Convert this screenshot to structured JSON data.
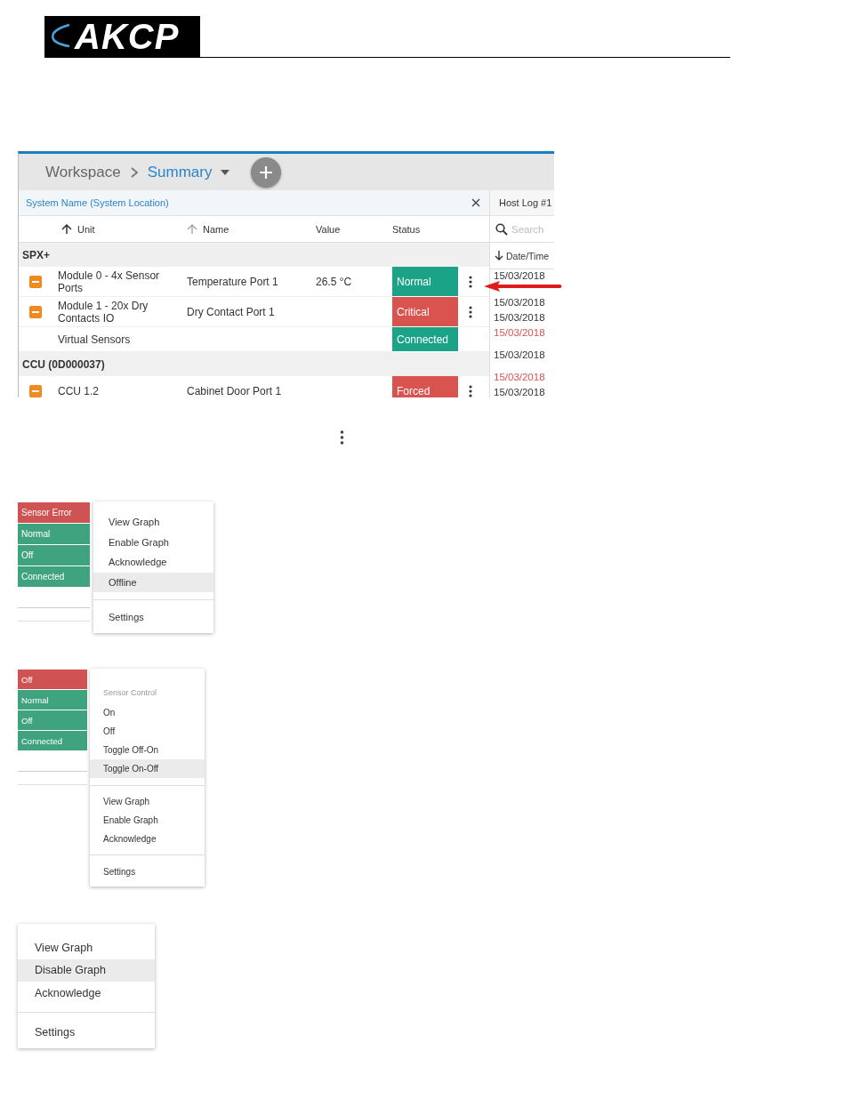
{
  "logo": {
    "text": "AKCP"
  },
  "summary_screen": {
    "breadcrumb": [
      {
        "label": "Workspace",
        "current": false
      },
      {
        "label": "Summary",
        "current": true
      }
    ],
    "panel": {
      "title": "System Name (System Location)",
      "columns": [
        {
          "label": "Unit",
          "sorted": true
        },
        {
          "label": "Name",
          "sorted": false
        },
        {
          "label": "Value"
        },
        {
          "label": "Status"
        }
      ],
      "groups": [
        {
          "name": "SPX+",
          "rows": [
            {
              "unit": "Module 0 - 4x Sensor Ports",
              "name": "Temperature Port 1",
              "value": "26.5 °C",
              "status": "Normal",
              "color": "#1aa386",
              "expandable": true,
              "has_menu": true
            },
            {
              "unit": "Module 1 - 20x Dry Contacts IO",
              "name": "Dry Contact Port 1",
              "status": "Critical",
              "color": "#d9534f",
              "expandable": true,
              "has_menu": true
            },
            {
              "unit": "Virtual Sensors",
              "status": "Connected",
              "color": "#1aa386",
              "expandable": false,
              "has_menu": false
            }
          ]
        },
        {
          "name": "CCU (0D000037)",
          "rows": [
            {
              "unit": "CCU 1.2",
              "name": "Cabinet Door Port 1",
              "status": "Forced",
              "color": "#d9534f",
              "expandable": true,
              "has_menu": true
            }
          ]
        }
      ]
    },
    "host_log": {
      "tab": "Host Log #1",
      "search_placeholder": "Search",
      "column": "Date/Time",
      "entries": [
        {
          "text": "15/03/2018",
          "alert": false
        },
        {
          "text": "15/03/2018",
          "alert": false
        },
        {
          "text": "15/03/2018",
          "alert": false
        },
        {
          "text": "15/03/2018",
          "alert": true
        },
        {
          "text": "15/03/2018",
          "alert": false
        },
        {
          "text": "15/03/2018",
          "alert": true
        },
        {
          "text": "15/03/2018",
          "alert": false
        }
      ]
    }
  },
  "menus": [
    {
      "status_cells": [
        {
          "label": "Sensor Error",
          "color": "#d05353"
        },
        {
          "label": "Normal",
          "color": "#3fa37f"
        },
        {
          "label": "Off",
          "color": "#3fa37f"
        },
        {
          "label": "Connected",
          "color": "#3fa37f"
        }
      ],
      "items": [
        {
          "kind": "item",
          "label": "View Graph",
          "selected": false
        },
        {
          "kind": "item",
          "label": "Enable Graph",
          "selected": false
        },
        {
          "kind": "item",
          "label": "Acknowledge",
          "selected": false
        },
        {
          "kind": "item",
          "label": "Offline",
          "selected": true
        },
        {
          "kind": "divider"
        },
        {
          "kind": "item",
          "label": "Settings",
          "selected": false
        }
      ]
    },
    {
      "status_cells": [
        {
          "label": "Off",
          "color": "#d05353"
        },
        {
          "label": "Normal",
          "color": "#3fa37f"
        },
        {
          "label": "Off",
          "color": "#3fa37f"
        },
        {
          "label": "Connected",
          "color": "#3fa37f"
        }
      ],
      "items": [
        {
          "kind": "header",
          "label": "Sensor Control"
        },
        {
          "kind": "item",
          "label": "On",
          "selected": false
        },
        {
          "kind": "item",
          "label": "Off",
          "selected": false
        },
        {
          "kind": "item",
          "label": "Toggle Off-On",
          "selected": false
        },
        {
          "kind": "item",
          "label": "Toggle On-Off",
          "selected": true
        },
        {
          "kind": "divider"
        },
        {
          "kind": "item",
          "label": "View Graph",
          "selected": false
        },
        {
          "kind": "item",
          "label": "Enable Graph",
          "selected": false
        },
        {
          "kind": "item",
          "label": "Acknowledge",
          "selected": false
        },
        {
          "kind": "divider"
        },
        {
          "kind": "item",
          "label": "Settings",
          "selected": false
        }
      ]
    },
    {
      "items": [
        {
          "kind": "item",
          "label": "View Graph",
          "selected": false
        },
        {
          "kind": "item",
          "label": "Disable Graph",
          "selected": true
        },
        {
          "kind": "item",
          "label": "Acknowledge",
          "selected": false
        },
        {
          "kind": "divider"
        },
        {
          "kind": "item",
          "label": "Settings",
          "selected": false
        }
      ]
    }
  ]
}
